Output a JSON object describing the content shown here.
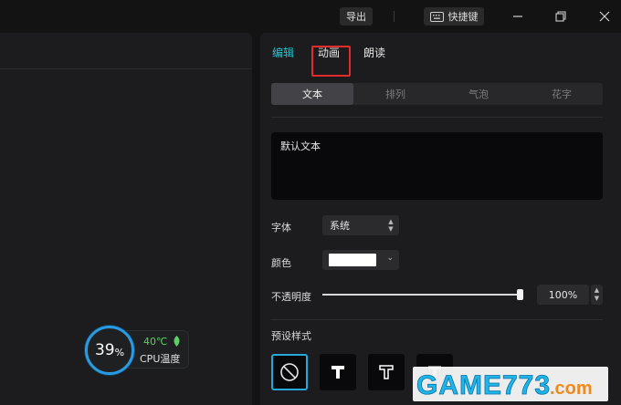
{
  "topbar": {
    "export_label": "导出",
    "shortcut_label": "快捷键",
    "icons": [
      "keyboard-icon",
      "minimize-icon",
      "restore-icon",
      "close-icon"
    ]
  },
  "right_panel": {
    "tabs": [
      {
        "label": "编辑",
        "active": true
      },
      {
        "label": "动画",
        "active": false
      },
      {
        "label": "朗读",
        "active": false
      }
    ],
    "subtabs": [
      {
        "label": "文本",
        "active": true
      },
      {
        "label": "排列",
        "active": false
      },
      {
        "label": "气泡",
        "active": false
      },
      {
        "label": "花字",
        "active": false
      }
    ],
    "text_value": "默认文本",
    "font": {
      "label": "字体",
      "value": "系统"
    },
    "color": {
      "label": "颜色",
      "value": "#ffffff"
    },
    "opacity": {
      "label": "不透明度",
      "value": "100%",
      "level": 1.0
    },
    "presets": {
      "label": "预设样式",
      "selected_index": 0
    }
  },
  "cpu_widget": {
    "usage": "39",
    "percent_sign": "%",
    "temperature": "40℃",
    "label": "CPU温度"
  },
  "watermark": {
    "text": "GAME773.com"
  },
  "colors": {
    "accent": "#27c4d0",
    "highlight_box": "#e22c2c",
    "cpu_ring": "#2b9ae0",
    "temp_green": "#5bd062"
  }
}
